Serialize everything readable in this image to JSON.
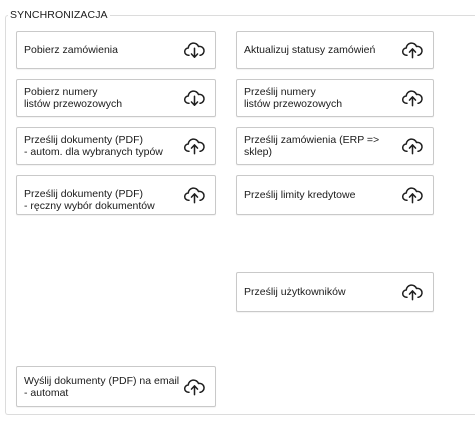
{
  "group": {
    "title": "SYNCHRONIZACJA"
  },
  "buttons": {
    "pobierz_zamowienia": {
      "label": "Pobierz zamówienia",
      "icon": "cloud-download-icon"
    },
    "aktualizuj_statusy": {
      "label": "Aktualizuj statusy zamówień",
      "icon": "cloud-upload-icon"
    },
    "pobierz_numery": {
      "label": "Pobierz numery\nlistów przewozowych",
      "icon": "cloud-download-icon"
    },
    "przeslij_numery": {
      "label": "Prześlij numery\nlistów przewozowych",
      "icon": "cloud-upload-icon"
    },
    "przeslij_dokumenty_autom": {
      "label": "Prześlij dokumenty (PDF)\n- autom. dla wybranych typów",
      "icon": "cloud-upload-icon"
    },
    "przeslij_zamowienia": {
      "label": "Prześlij zamówienia (ERP =>\nsklep)",
      "icon": "cloud-upload-icon"
    },
    "przeslij_dokumenty_reczny": {
      "label": "Prześlij dokumenty (PDF)\n- ręczny wybór dokumentów",
      "icon": "cloud-upload-icon"
    },
    "przeslij_limity": {
      "label": "Prześlij limity kredytowe",
      "icon": "cloud-upload-icon"
    },
    "przeslij_uzytkownikow": {
      "label": "Prześlij użytkowników",
      "icon": "cloud-upload-icon"
    },
    "wyslij_dokumenty_email": {
      "label": "Wyślij dokumenty (PDF) na email\n- automat",
      "icon": "cloud-upload-icon"
    }
  }
}
